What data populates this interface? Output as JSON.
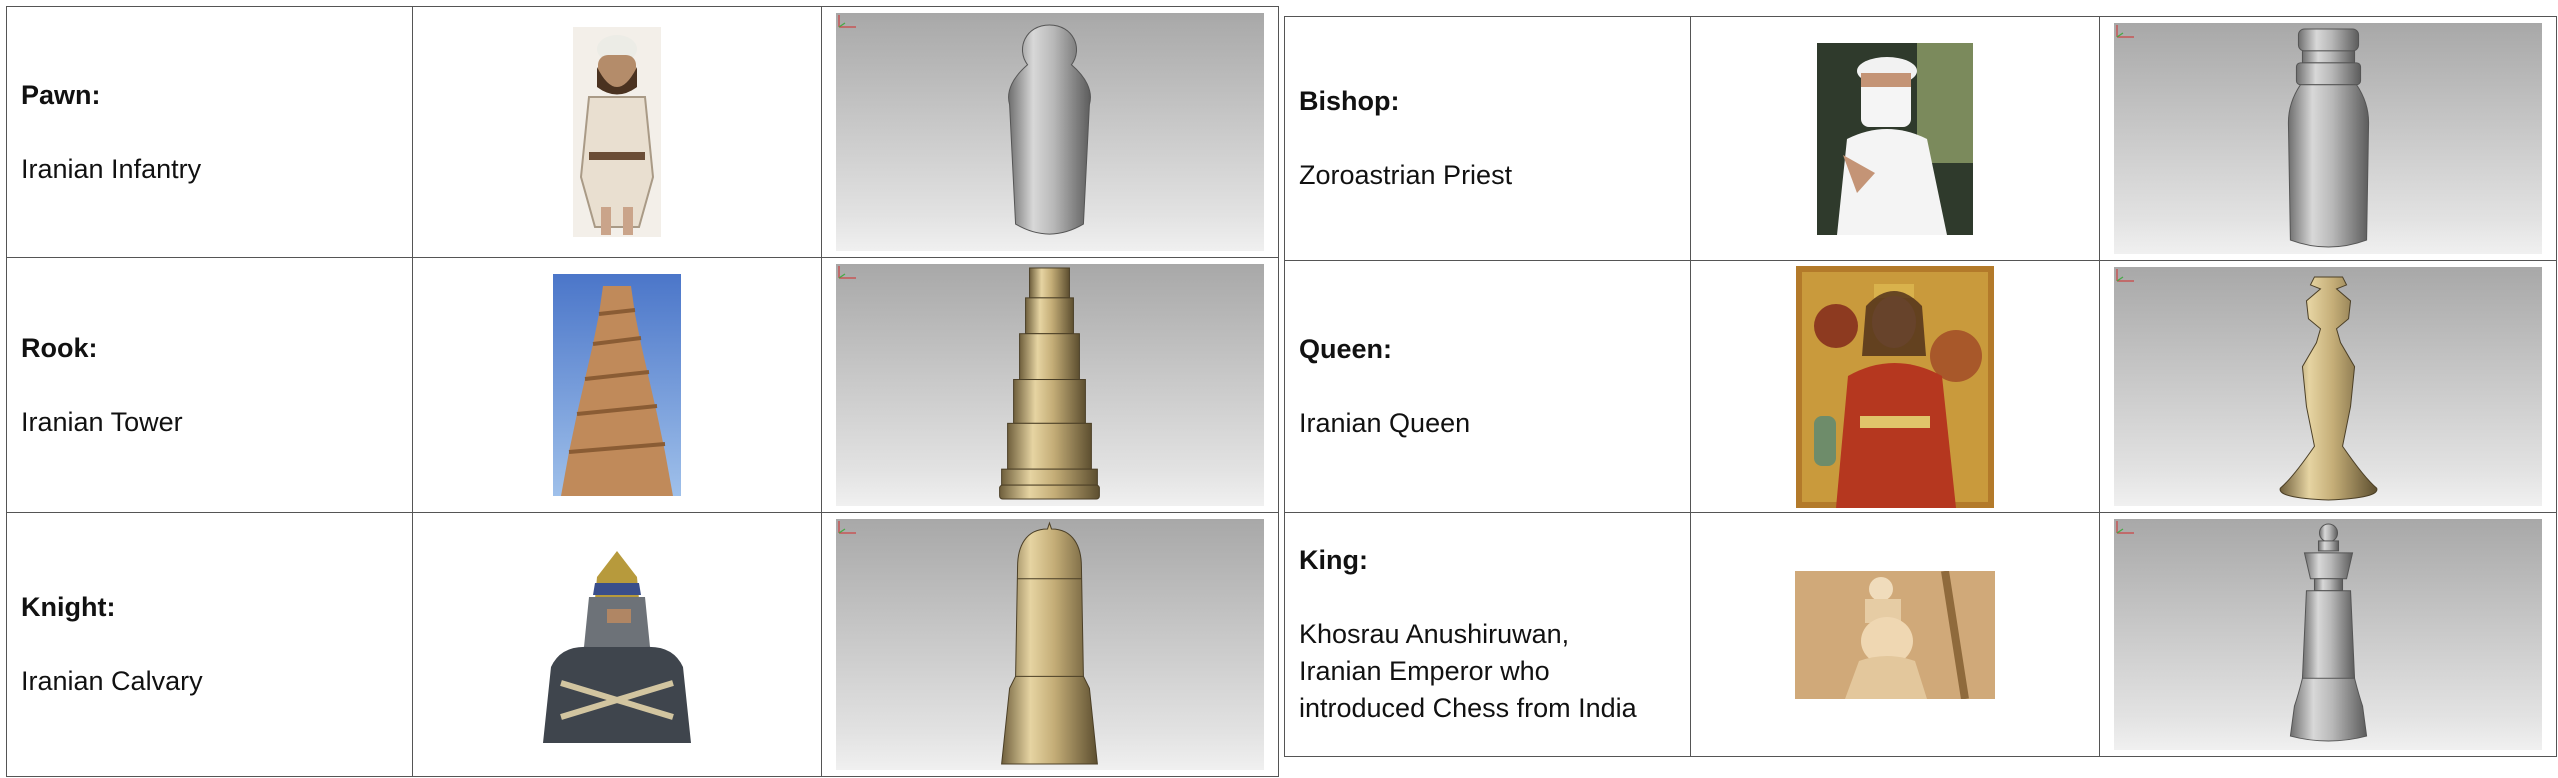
{
  "left_table": {
    "rows": [
      {
        "piece": "Pawn:",
        "description": "Iranian Infantry",
        "photo_icon": "infantry-soldier-image",
        "model_icon": "pawn-3d-model"
      },
      {
        "piece": "Rook:",
        "description": "Iranian Tower",
        "photo_icon": "spiral-tower-image",
        "model_icon": "rook-3d-model"
      },
      {
        "piece": "Knight:",
        "description": "Iranian Calvary",
        "photo_icon": "armored-cavalryman-image",
        "model_icon": "knight-3d-model"
      }
    ]
  },
  "right_table": {
    "rows": [
      {
        "piece": "Bishop:",
        "description": "Zoroastrian Priest",
        "photo_icon": "zoroastrian-priest-image",
        "model_icon": "bishop-3d-model"
      },
      {
        "piece": "Queen:",
        "description": "Iranian Queen",
        "photo_icon": "queen-painting-image",
        "model_icon": "queen-3d-model"
      },
      {
        "piece": "King:",
        "description_lines": [
          "Khosrau Anushiruwan,",
          "Iranian Emperor who",
          "introduced Chess from India"
        ],
        "photo_icon": "emperor-relief-image",
        "model_icon": "king-3d-model"
      }
    ]
  },
  "colors": {
    "silver": "#b5b5b5",
    "gold": "#c9b27a",
    "border": "#555555"
  }
}
